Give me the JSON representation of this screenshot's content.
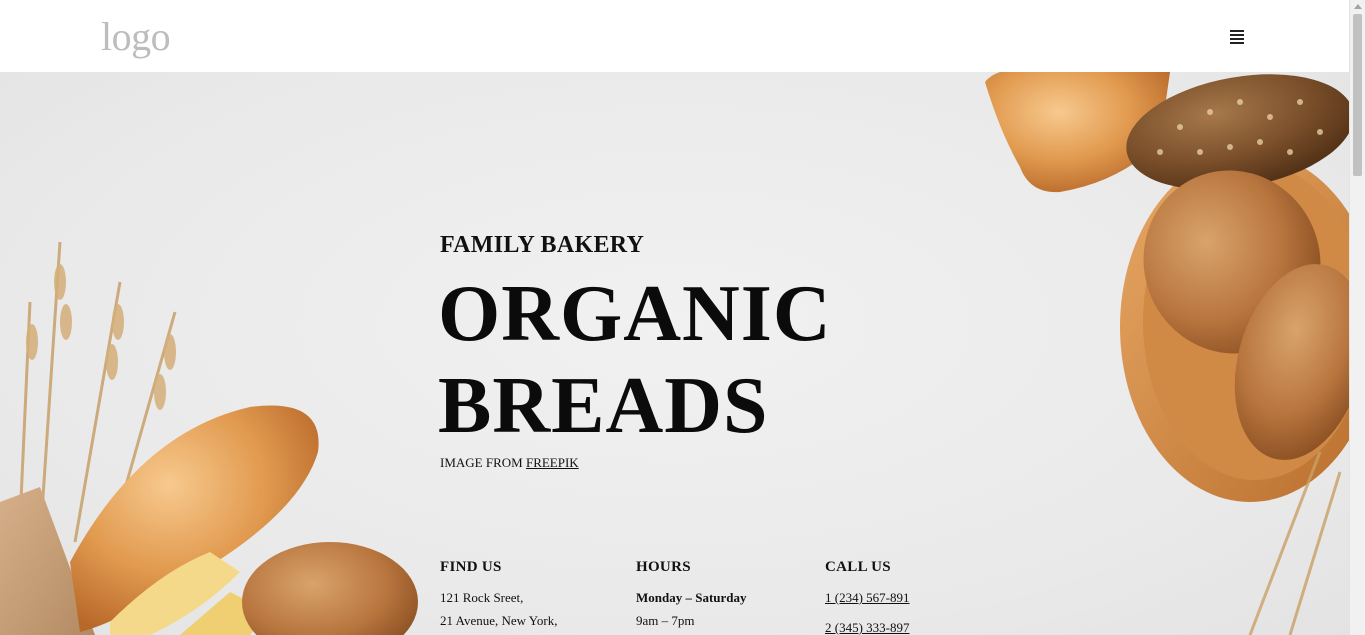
{
  "header": {
    "logo_text": "logo",
    "menu_icon": "hamburger-menu-icon"
  },
  "hero": {
    "kicker": "FAMILY BAKERY",
    "headline_line1": "ORGANIC",
    "headline_line2": "BREADS",
    "credit_prefix": "IMAGE FROM",
    "credit_link": "FREEPIK"
  },
  "info": {
    "find_us": {
      "title": "FIND US",
      "lines": [
        "121 Rock Sreet,",
        "21 Avenue, New York,"
      ]
    },
    "hours": {
      "title": "HOURS",
      "days": "Monday – Saturday",
      "time": "9am – 7pm"
    },
    "call_us": {
      "title": "CALL US",
      "phones": [
        "1 (234) 567-891",
        "2 (345) 333-897"
      ]
    }
  },
  "colors": {
    "logo": "#bdbdbd",
    "background": "#e9e9e9",
    "text": "#111111"
  }
}
